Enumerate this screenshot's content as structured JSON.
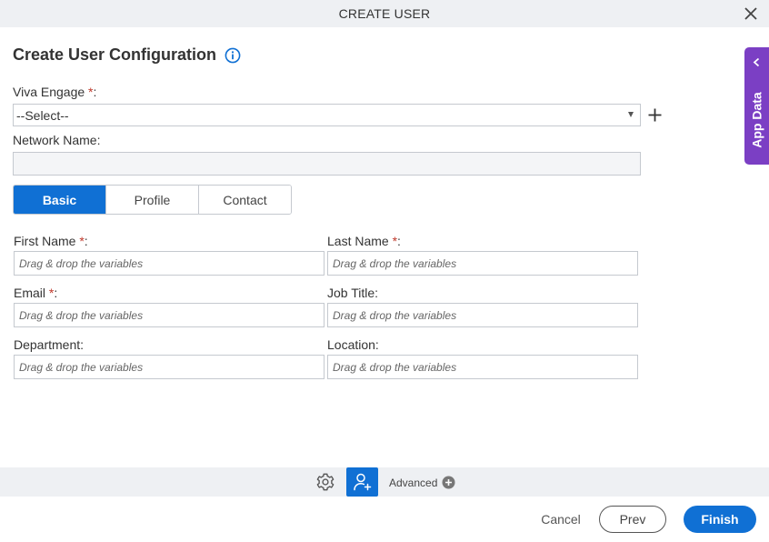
{
  "dialog": {
    "title": "CREATE USER"
  },
  "heading": "Create User Configuration",
  "viva_engage": {
    "label": "Viva Engage",
    "required_mark": "*",
    "suffix": ":",
    "selected": "--Select--"
  },
  "network_name": {
    "label": "Network Name:",
    "value": ""
  },
  "tabs": [
    {
      "label": "Basic",
      "active": true
    },
    {
      "label": "Profile",
      "active": false
    },
    {
      "label": "Contact",
      "active": false
    }
  ],
  "fields": {
    "first_name": {
      "label": "First Name",
      "required_mark": "*",
      "suffix": ":",
      "placeholder": "Drag & drop the variables"
    },
    "last_name": {
      "label": "Last Name",
      "required_mark": "*",
      "suffix": ":",
      "placeholder": "Drag & drop the variables"
    },
    "email": {
      "label": "Email",
      "required_mark": "*",
      "suffix": ":",
      "placeholder": "Drag & drop the variables"
    },
    "job_title": {
      "label": "Job Title:",
      "placeholder": "Drag & drop the variables"
    },
    "department": {
      "label": "Department:",
      "placeholder": "Drag & drop the variables"
    },
    "location": {
      "label": "Location:",
      "placeholder": "Drag & drop the variables"
    }
  },
  "toolbar": {
    "advanced_label": "Advanced"
  },
  "footer": {
    "cancel": "Cancel",
    "prev": "Prev",
    "finish": "Finish"
  },
  "side_panel": {
    "label": "App Data"
  },
  "icons": {
    "close": "close-icon",
    "info": "info-icon",
    "add": "plus-icon",
    "settings": "gear-icon",
    "user": "add-user-icon",
    "advanced": "plus-circle-icon",
    "collapse": "chevron-left-icon"
  },
  "colors": {
    "primary": "#1070d4",
    "side_panel": "#7b3fc4",
    "required": "#c0392b",
    "bar_bg": "#eef0f3"
  }
}
